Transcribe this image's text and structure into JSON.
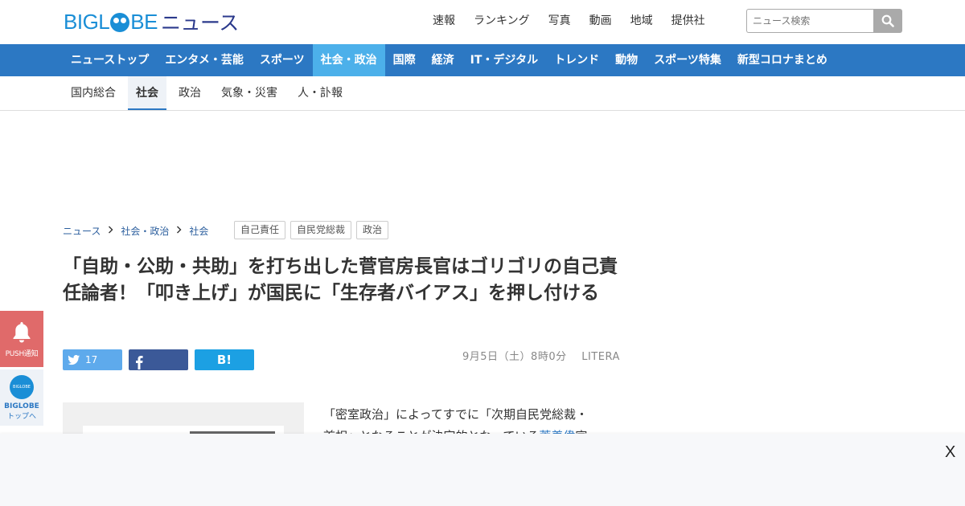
{
  "header": {
    "logo_left": "BIGL",
    "logo_right": "BE",
    "logo_suffix": "ニュース",
    "links": [
      "速報",
      "ランキング",
      "写真",
      "動画",
      "地域",
      "提供社"
    ],
    "search_placeholder": "ニュース検索"
  },
  "mainnav": {
    "items": [
      "ニューストップ",
      "エンタメ・芸能",
      "スポーツ",
      "社会・政治",
      "国際",
      "経済",
      "IT・デジタル",
      "トレンド",
      "動物",
      "スポーツ特集",
      "新型コロナまとめ"
    ],
    "active_index": 3,
    "color": "#2c78c3",
    "active_color": "#4cb0ea"
  },
  "subnav": {
    "items": [
      "国内総合",
      "社会",
      "政治",
      "気象・災害",
      "人・訃報"
    ],
    "active_index": 1
  },
  "breadcrumb": [
    "ニュース",
    "社会・政治",
    "社会"
  ],
  "tags": [
    "自己責任",
    "自民党総裁",
    "政治"
  ],
  "article": {
    "title": "「自助・公助・共助」を打ち出した菅官房長官はゴリゴリの自己責任論者！「叩き上げ」が国民に「生存者バイアス」を押し付ける",
    "date": "9月5日（土）8時0分",
    "source": "LITERA",
    "body_line1": "「密室政治」によってすでに「次期自民党総裁・",
    "body_line2_pre": "首相」となることが決定的となっている",
    "body_line2_link": "菅義偉",
    "body_line2_post": "官"
  },
  "share": {
    "twitter_count": "17",
    "hatena_label": "B!"
  },
  "side": {
    "push_label": "PUSH通知",
    "biglobe_label": "BIGLOBE",
    "top_label": "トップへ",
    "mascot_text": "BIGLOBE"
  },
  "overlay": {
    "close_label": "X"
  }
}
